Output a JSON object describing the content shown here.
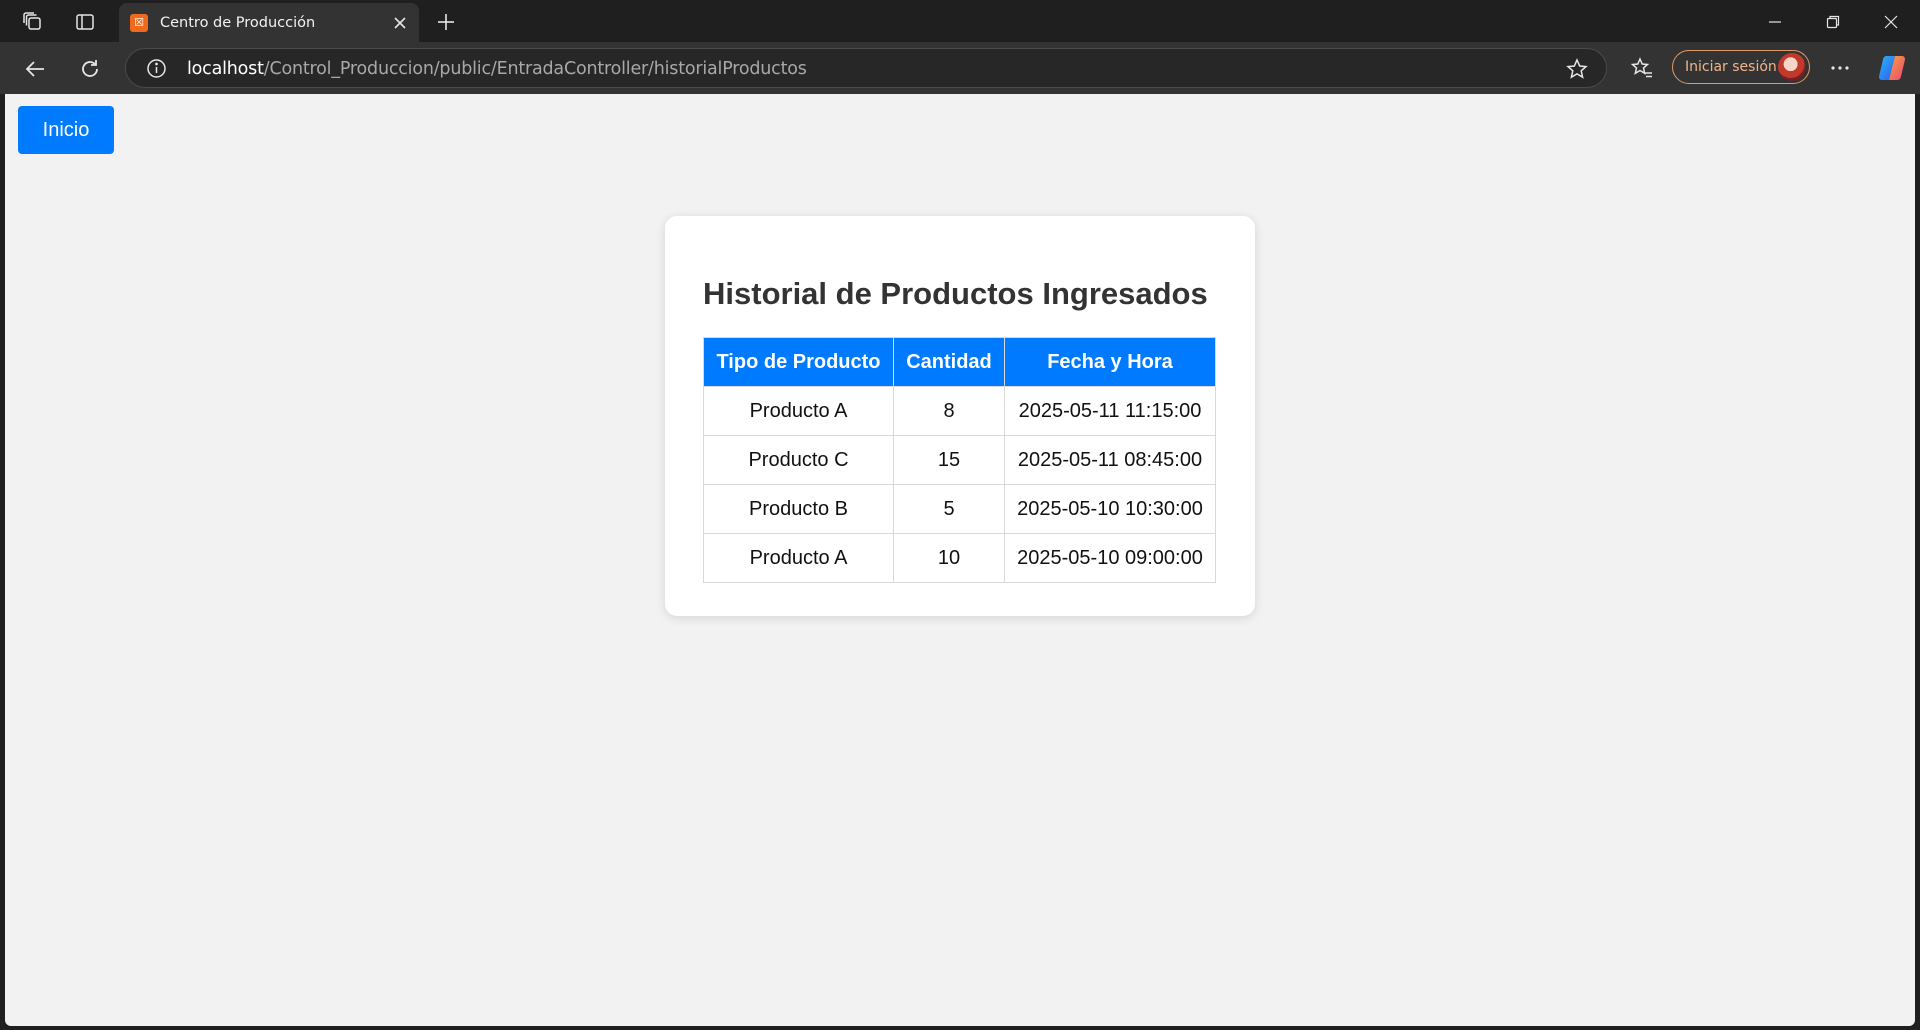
{
  "browser": {
    "tab": {
      "title": "Centro de Producción",
      "favicon_glyph": "☒"
    },
    "url": {
      "host": "localhost",
      "path": "/Control_Produccion/public/EntradaController/historialProductos"
    },
    "signin_label": "Iniciar sesión",
    "icons": [
      "workspaces-icon",
      "tab-actions-icon",
      "tab-close-icon",
      "new-tab-icon",
      "minimize-icon",
      "restore-icon",
      "window-close-icon",
      "back-icon",
      "refresh-icon",
      "site-info-icon",
      "favorite-star-icon",
      "favorites-icon",
      "more-menu-icon",
      "copilot-icon"
    ]
  },
  "page": {
    "inicio_button": "Inicio",
    "title": "Historial de Productos Ingresados",
    "table": {
      "headers": [
        "Tipo de Producto",
        "Cantidad",
        "Fecha y Hora"
      ],
      "rows": [
        [
          "Producto A",
          "8",
          "2025-05-11 11:15:00"
        ],
        [
          "Producto C",
          "15",
          "2025-05-11 08:45:00"
        ],
        [
          "Producto B",
          "5",
          "2025-05-10 10:30:00"
        ],
        [
          "Producto A",
          "10",
          "2025-05-10 09:00:00"
        ]
      ]
    }
  },
  "colors": {
    "accent_blue": "#007bff",
    "page_background": "#f2f2f2",
    "chrome_dark": "#1f1f1f",
    "toolbar": "#333333"
  }
}
